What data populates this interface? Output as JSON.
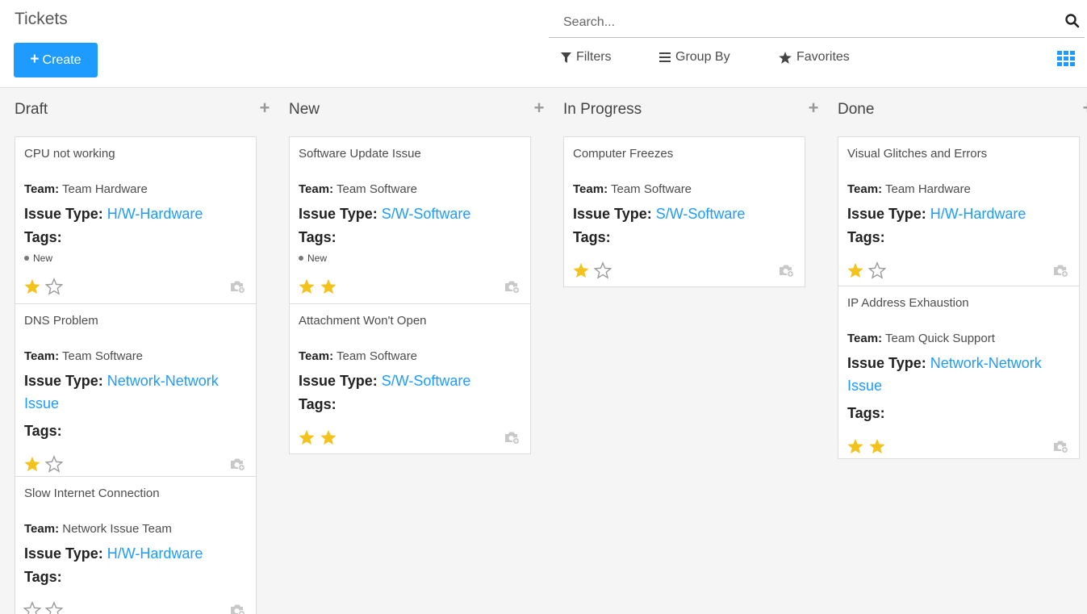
{
  "header": {
    "title": "Tickets",
    "create_label": "Create",
    "search_placeholder": "Search...",
    "filters_label": "Filters",
    "group_by_label": "Group By",
    "favorites_label": "Favorites"
  },
  "labels": {
    "team": "Team:",
    "issue_type": "Issue Type:",
    "tags": "Tags:"
  },
  "colors": {
    "accent": "#1e9bff",
    "star_filled": "#f3c31b",
    "star_empty": "#999999"
  },
  "columns": [
    {
      "title": "Draft",
      "cards": [
        {
          "name": "CPU not working",
          "team": "Team Hardware",
          "issue_type": "H/W-Hardware",
          "tag": "New",
          "stars": 1
        },
        {
          "name": "DNS Problem",
          "team": "Team Software",
          "issue_type": "Network-Network Issue",
          "tag": "",
          "stars": 1
        },
        {
          "name": "Slow Internet Connection",
          "team": "Network Issue Team",
          "issue_type": "H/W-Hardware",
          "tag": "",
          "stars": 0
        }
      ]
    },
    {
      "title": "New",
      "cards": [
        {
          "name": "Software Update Issue",
          "team": "Team Software",
          "issue_type": "S/W-Software",
          "tag": "New",
          "stars": 2
        },
        {
          "name": "Attachment Won't Open",
          "team": "Team Software",
          "issue_type": "S/W-Software",
          "tag": "",
          "stars": 2
        }
      ]
    },
    {
      "title": "In Progress",
      "cards": [
        {
          "name": "Computer Freezes",
          "team": "Team Software",
          "issue_type": "S/W-Software",
          "tag": "",
          "stars": 1
        }
      ]
    },
    {
      "title": "Done",
      "cards": [
        {
          "name": "Visual Glitches and Errors",
          "team": "Team Hardware",
          "issue_type": "H/W-Hardware",
          "tag": "",
          "stars": 1
        },
        {
          "name": "IP Address Exhaustion",
          "team": "Team Quick Support",
          "issue_type": "Network-Network Issue",
          "tag": "",
          "stars": 2
        }
      ]
    }
  ]
}
